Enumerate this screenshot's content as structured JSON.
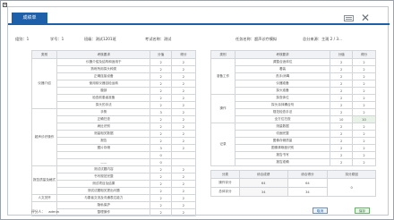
{
  "app": {
    "corner_glyph": "▪",
    "tab_label": "成绩单",
    "close_glyph": "✕"
  },
  "info": {
    "group": "组别：1",
    "number": "学号：1",
    "class": "班级：测试1201班",
    "exam_name": "考试名称：测试",
    "task_name": "任务名称：超声诊疗模拟",
    "score_from": "总分来源：主观 2 / 3..."
  },
  "left_table": {
    "headers": [
      "类别",
      "考核要求",
      "分值",
      "得分"
    ],
    "rows": [
      {
        "cat": "仪器介绍",
        "req": "仪器介绍及结构和适用于",
        "score": "2",
        "got": "2"
      },
      {
        "cat": "",
        "req": "熟练所用探头种类",
        "score": "2",
        "got": "2"
      },
      {
        "cat": "",
        "req": "正确连接设备",
        "score": "2",
        "got": "2"
      },
      {
        "cat": "",
        "req": "使用前仪器自检运转",
        "score": "2",
        "got": "2"
      },
      {
        "cat": "",
        "req": "腹部",
        "score": "2",
        "got": "2"
      },
      {
        "cat": "",
        "req": "检查前患者准备",
        "score": "2",
        "got": "2"
      },
      {
        "cat": "",
        "req": "探头的手法",
        "score": "2",
        "got": "2"
      },
      {
        "cat": "超声诊疗操作",
        "req": "手势",
        "score": "3",
        "got": "2"
      },
      {
        "cat": "",
        "req": "正确扫查",
        "score": "2",
        "got": "2"
      },
      {
        "cat": "",
        "req": "病灶识别",
        "score": "2",
        "got": "2"
      },
      {
        "cat": "",
        "req": "测量相关数据",
        "score": "2",
        "got": "2"
      },
      {
        "cat": "",
        "req": "报告",
        "score": "2",
        "got": "2"
      },
      {
        "cat": "",
        "req": "图片存储",
        "score": "3",
        "got": "2"
      },
      {
        "cat": "",
        "req": "",
        "score": "0",
        "got": ""
      },
      {
        "cat": "",
        "req": "——",
        "score": "0",
        "got": ""
      },
      {
        "cat": "报告质量及格式",
        "req": "测试试题内容",
        "score": "2",
        "got": "2"
      },
      {
        "cat": "",
        "req": "书写规范完整",
        "score": "2",
        "got": "2"
      },
      {
        "cat": "",
        "req": "测试项目及结果",
        "score": "2",
        "got": "2"
      },
      {
        "cat": "",
        "req": "测试试题相关提出问题",
        "score": "2",
        "got": "2"
      },
      {
        "cat": "人文关怀",
        "req": "与患者交流及沟通表达能力",
        "score": "2",
        "got": "2"
      },
      {
        "cat": "",
        "req": "隐私保护",
        "score": "2",
        "got": "2"
      },
      {
        "cat": "",
        "req": "整理操作",
        "score": "2",
        "got": "2"
      }
    ]
  },
  "right_table": {
    "headers": [
      "类别",
      "考核要求",
      "分值",
      "得分"
    ],
    "rows": [
      {
        "cat": "准备工作",
        "req": "调整合适体位",
        "score": "2",
        "got": "2"
      },
      {
        "cat": "",
        "req": "着装",
        "score": "2",
        "got": "2"
      },
      {
        "cat": "",
        "req": "洗手/消毒",
        "score": "2",
        "got": "2"
      },
      {
        "cat": "",
        "req": "仪器准备",
        "score": "2",
        "got": "2"
      },
      {
        "cat": "",
        "req": "探头准备",
        "score": "2",
        "got": "2"
      },
      {
        "cat": "操作",
        "req": "探查体位",
        "score": "2",
        "got": "2"
      },
      {
        "cat": "",
        "req": "探头涂抹耦合剂",
        "score": "2",
        "got": "2"
      },
      {
        "cat": "",
        "req": "规范检查手法",
        "score": "2",
        "got": "2"
      },
      {
        "cat": "",
        "req": "全方位扫查",
        "score": "10",
        "got": "10"
      },
      {
        "cat": "记录",
        "req": "测量数据",
        "score": "2",
        "got": "2"
      },
      {
        "cat": "",
        "req": "切面完整",
        "score": "2",
        "got": "2"
      },
      {
        "cat": "",
        "req": "图像存储质量",
        "score": "2",
        "got": "2"
      },
      {
        "cat": "",
        "req": "图像清晰度识别",
        "score": "2",
        "got": "2"
      },
      {
        "cat": "",
        "req": "报告书写",
        "score": "2",
        "got": "2"
      },
      {
        "cat": "",
        "req": "报告准确",
        "score": "2",
        "got": "2"
      }
    ]
  },
  "summary": {
    "headers": [
      "分类",
      "综合成绩",
      "综合得分",
      "扣分原因"
    ],
    "rows": [
      {
        "name": "操作评分",
        "a": "64",
        "b": "64",
        "reason": "0"
      },
      {
        "name": "总体评分",
        "a": "34",
        "b": "34",
        "reason": ""
      }
    ]
  },
  "footer": {
    "rater": "评分人：",
    "rater_name": "admin",
    "btn_cancel": "取消",
    "btn_submit": "保存"
  }
}
